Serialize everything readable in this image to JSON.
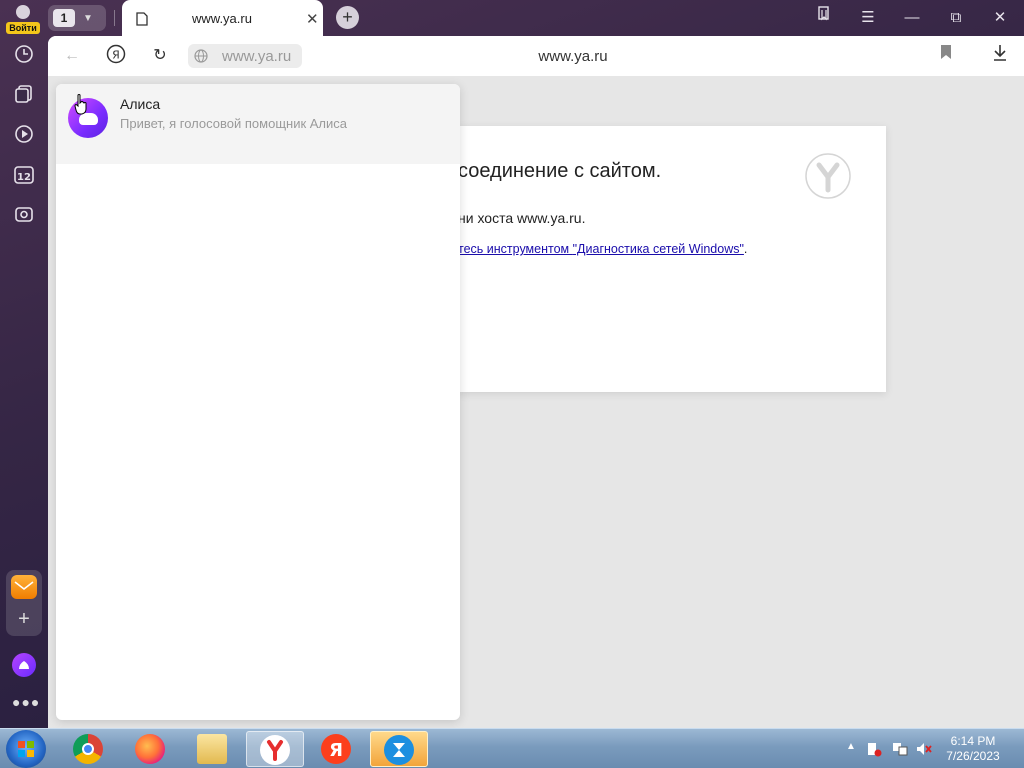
{
  "titlebar": {
    "login_label": "Войти",
    "tab_count": "1",
    "tab_title": "www.ya.ru"
  },
  "toolbar": {
    "address_text": "www.ya.ru",
    "page_title": "www.ya.ru"
  },
  "error_page": {
    "title": "соединение с сайтом.",
    "host_line": "ни хоста www.ya.ru.",
    "hint_prefix": "тесь инструментом ",
    "hint_link": "\"Диагностика сетей Windows\"",
    "hint_suffix": "."
  },
  "suggest": {
    "items": [
      {
        "title": "Алиса",
        "subtitle": "Привет, я голосовой помощник Алиса",
        "icon": "alice-icon"
      }
    ]
  },
  "taskbar": {
    "apps": [
      "chrome-icon",
      "firefox-icon",
      "explorer-icon",
      "yandex-browser-icon",
      "yandex-icon",
      "hourglass-app-icon"
    ],
    "clock_time": "6:14 PM",
    "clock_date": "7/26/2023"
  },
  "colors": {
    "window_bg": "#352645",
    "login_badge": "#f4c61b",
    "alice_purple": "#7a2cff",
    "link_blue": "#1a0dab"
  }
}
